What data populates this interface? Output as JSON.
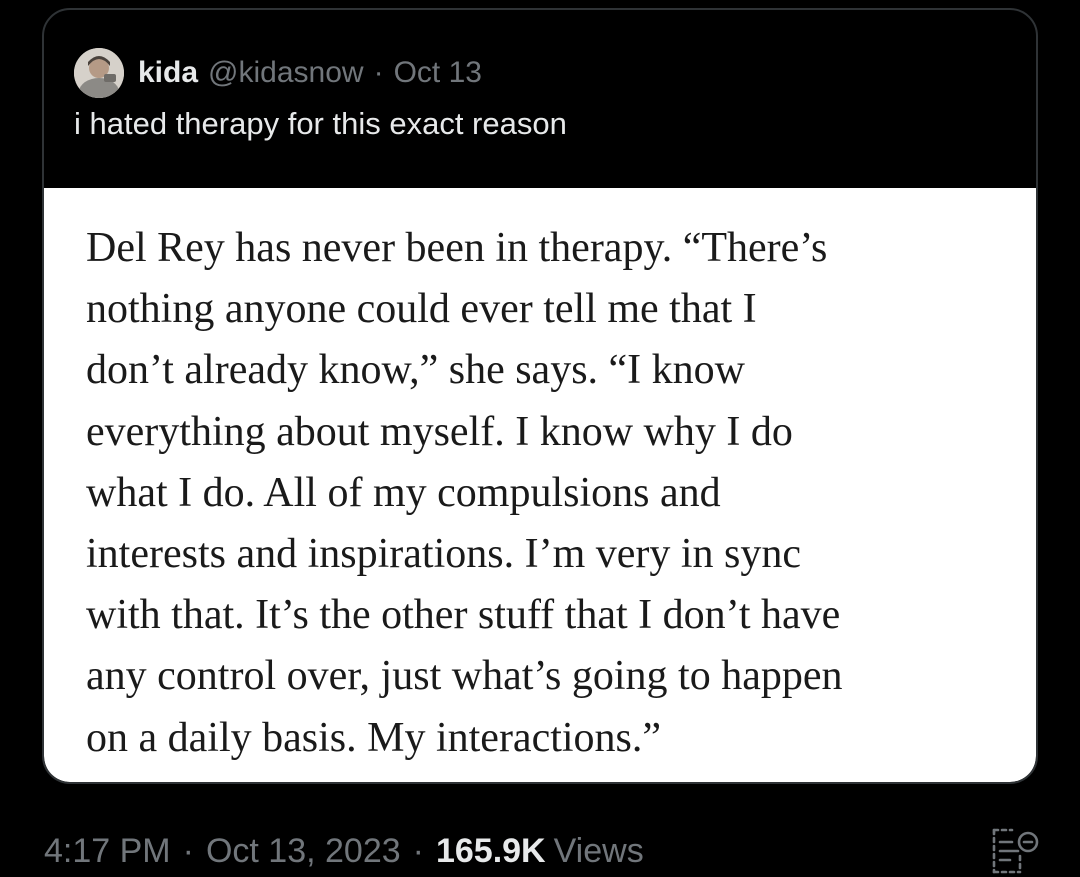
{
  "quoted_tweet": {
    "display_name": "kida",
    "handle": "@kidasnow",
    "separator": "·",
    "date": "Oct 13",
    "text": "i hated therapy for this exact reason",
    "avatar_icon": "avatar-photo",
    "image_text_lines": [
      "Del Rey has never been in therapy. “There’s",
      "nothing anyone could ever tell me that I",
      "don’t already know,” she says. “I know",
      "everything about myself. I know why I do",
      "what I do. All of my compulsions and",
      "interests and inspirations. I’m very in sync",
      "with that. It’s the other stuff that I don’t have",
      "any control over, just what’s going to happen",
      "on a daily basis. My interactions.”"
    ]
  },
  "meta": {
    "time": "4:17 PM",
    "separator": "·",
    "date": "Oct 13, 2023",
    "views_count": "165.9K",
    "views_label": "Views",
    "analytics_icon": "analytics-icon"
  },
  "colors": {
    "background": "#000000",
    "text_primary": "#e7e9ea",
    "text_secondary": "#71767b",
    "border": "#2f3336",
    "image_background": "#ffffff",
    "image_text": "#1a1a1a"
  }
}
